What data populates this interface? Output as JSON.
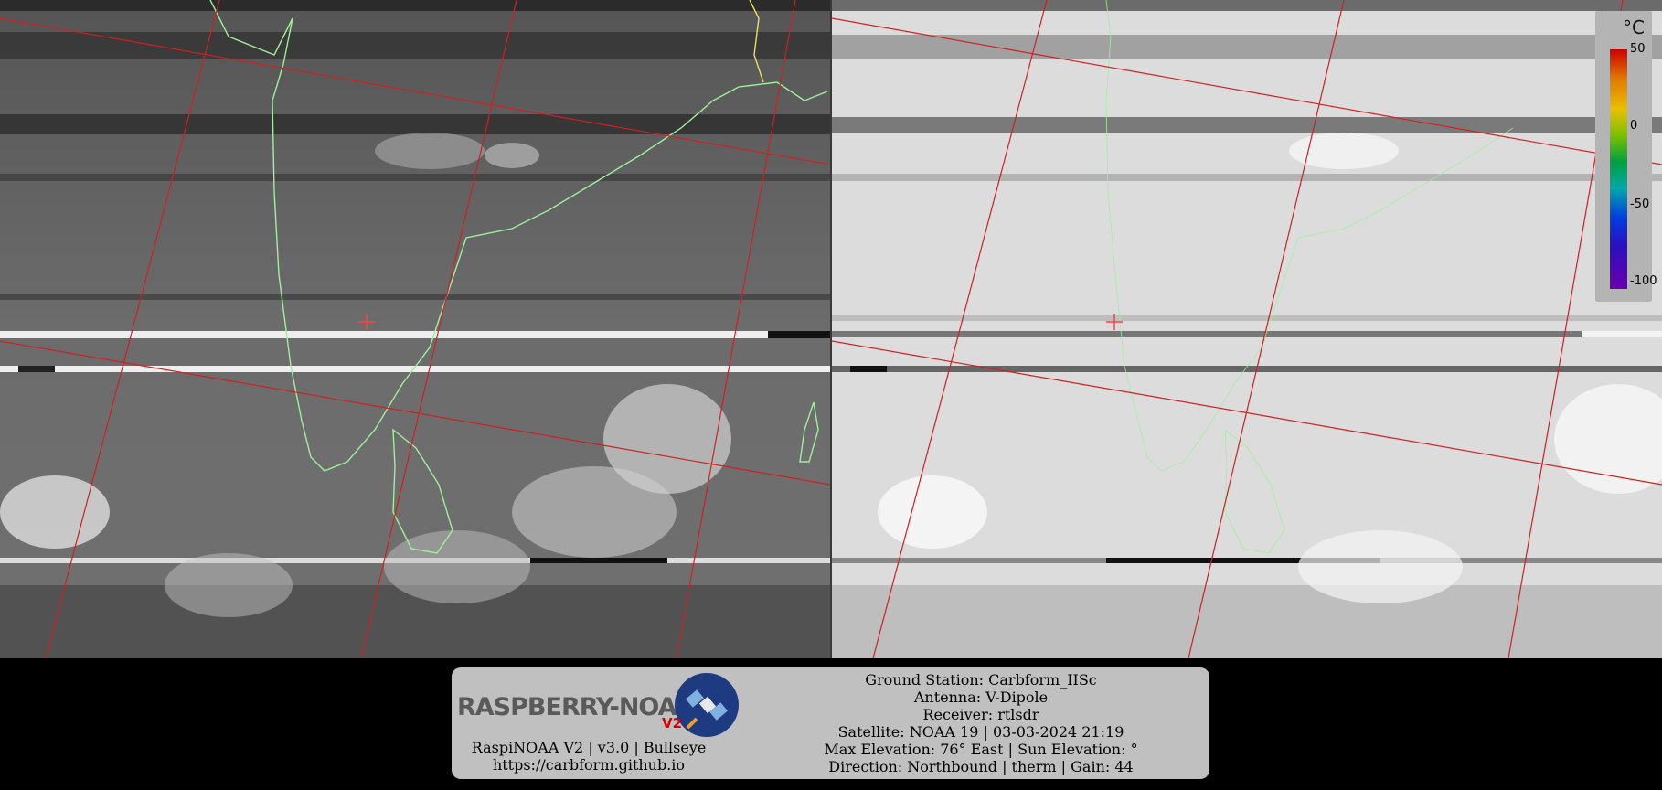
{
  "colorbar": {
    "unit": "°C",
    "ticks": [
      "50",
      "0",
      "-50",
      "-100"
    ]
  },
  "footer": {
    "logo_text": "RASPBERRY-NOAA",
    "logo_version": "V2",
    "software": "RaspiNOAA V2 | v3.0 | Bullseye",
    "website": "https://carbform.github.io",
    "station_lines": [
      "Ground Station: Carbform_IISc",
      "Antenna: V-Dipole",
      "Receiver: rtlsdr",
      "Satellite: NOAA 19 | 03-03-2024 21:19",
      "Max Elevation: 76° East | Sun Elevation: °",
      "Direction: Northbound | therm | Gain: 44"
    ]
  },
  "colors": {
    "coastline": "#9ef09a",
    "grid": "#d02020",
    "marker": "#ff4040"
  }
}
